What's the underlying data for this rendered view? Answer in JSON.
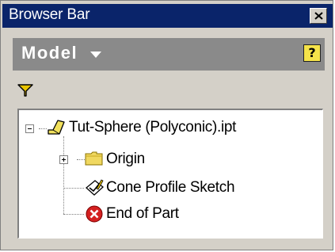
{
  "window": {
    "title": "Browser Bar",
    "close_icon": "close-icon"
  },
  "header": {
    "mode_label": "Model",
    "dropdown_icon": "chevron-down-icon",
    "help_icon": "help-icon",
    "help_glyph": "?"
  },
  "toolbar": {
    "filter_icon": "filter-icon"
  },
  "tree": {
    "root": {
      "label": "Tut-Sphere (Polyconic).ipt",
      "icon": "part-icon",
      "expanded": true
    },
    "items": [
      {
        "label": "Origin",
        "icon": "folder-icon",
        "expanded": false
      },
      {
        "label": "Cone Profile Sketch",
        "icon": "sketch-icon"
      },
      {
        "label": "End of Part",
        "icon": "end-of-part-icon"
      }
    ]
  },
  "colors": {
    "titlebar": "#0a246a",
    "panel": "#d4d0c8",
    "header_bar": "#8a8a8a",
    "filter": "#e8c400",
    "folder": "#f0d860",
    "end_of_part": "#d42020"
  }
}
